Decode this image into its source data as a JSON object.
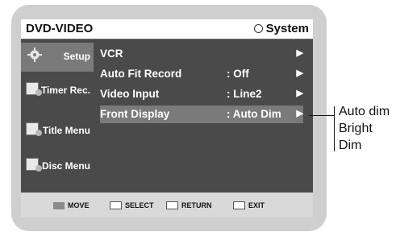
{
  "header": {
    "left_title": "DVD-VIDEO",
    "right_title": "System"
  },
  "sidebar": {
    "items": [
      {
        "label": "Setup",
        "icon": "gear-icon",
        "active": true
      },
      {
        "label": "Timer Rec.",
        "icon": "timer-icon",
        "active": false
      },
      {
        "label": "Title Menu",
        "icon": "title-menu-icon",
        "active": false
      },
      {
        "label": "Disc Menu",
        "icon": "disc-menu-icon",
        "active": false
      }
    ]
  },
  "menu": {
    "rows": [
      {
        "name": "VCR",
        "value": "",
        "arrow": "▶"
      },
      {
        "name": "Auto Fit Record",
        "value": ": Off",
        "arrow": "▶"
      },
      {
        "name": "Video Input",
        "value": ": Line2",
        "arrow": "▶"
      },
      {
        "name": "Front Display",
        "value": ": Auto Dim",
        "arrow": "▶",
        "selected": true
      }
    ]
  },
  "footer": {
    "move": "MOVE",
    "select": "SELECT",
    "return": "RETURN",
    "exit": "EXIT"
  },
  "options": [
    "Auto dim",
    "Bright",
    "Dim"
  ]
}
